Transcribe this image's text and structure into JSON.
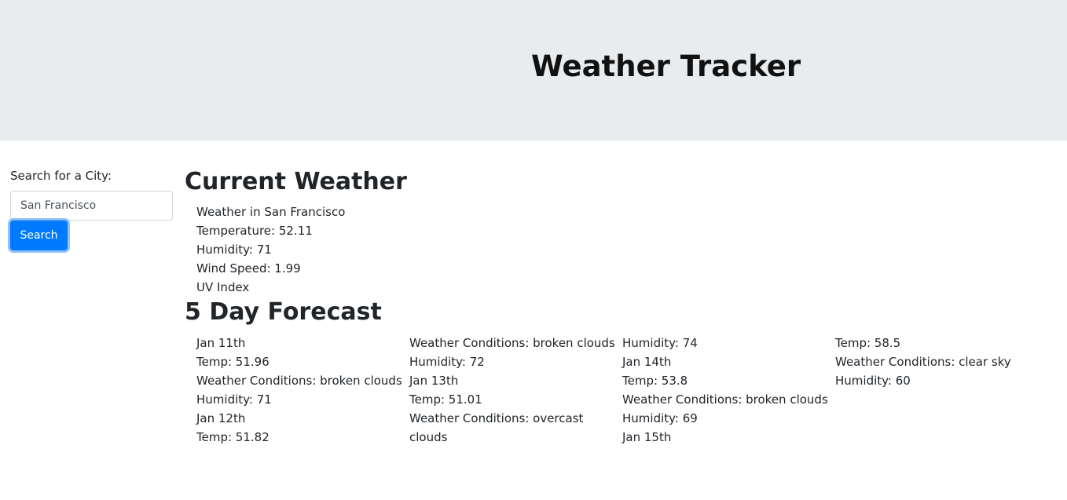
{
  "header": {
    "title": "Weather Tracker",
    "background_color": "#e9ecef"
  },
  "search": {
    "label": "Search for a City:",
    "value": "San Francisco",
    "button_label": "Search",
    "button_color": "#007bff"
  },
  "current": {
    "heading": "Current Weather",
    "lines": [
      "Weather in San Francisco",
      "Temperature: 52.11",
      "Humidity: 71",
      "Wind Speed: 1.99",
      "UV Index"
    ]
  },
  "forecast": {
    "heading": "5 Day Forecast",
    "columns": [
      [
        "Jan 11th",
        "Temp: 51.96",
        "Weather Conditions: broken clouds",
        "Humidity: 71",
        "Jan 12th",
        "Temp: 51.82"
      ],
      [
        "Weather Conditions: broken clouds",
        "Humidity: 72",
        "Jan 13th",
        "Temp: 51.01",
        "Weather Conditions: overcast clouds"
      ],
      [
        "Humidity: 74",
        "Jan 14th",
        "Temp: 53.8",
        "Weather Conditions: broken clouds",
        "Humidity: 69",
        "Jan 15th"
      ],
      [
        "Temp: 58.5",
        "Weather Conditions: clear sky",
        "Humidity: 60"
      ]
    ]
  }
}
